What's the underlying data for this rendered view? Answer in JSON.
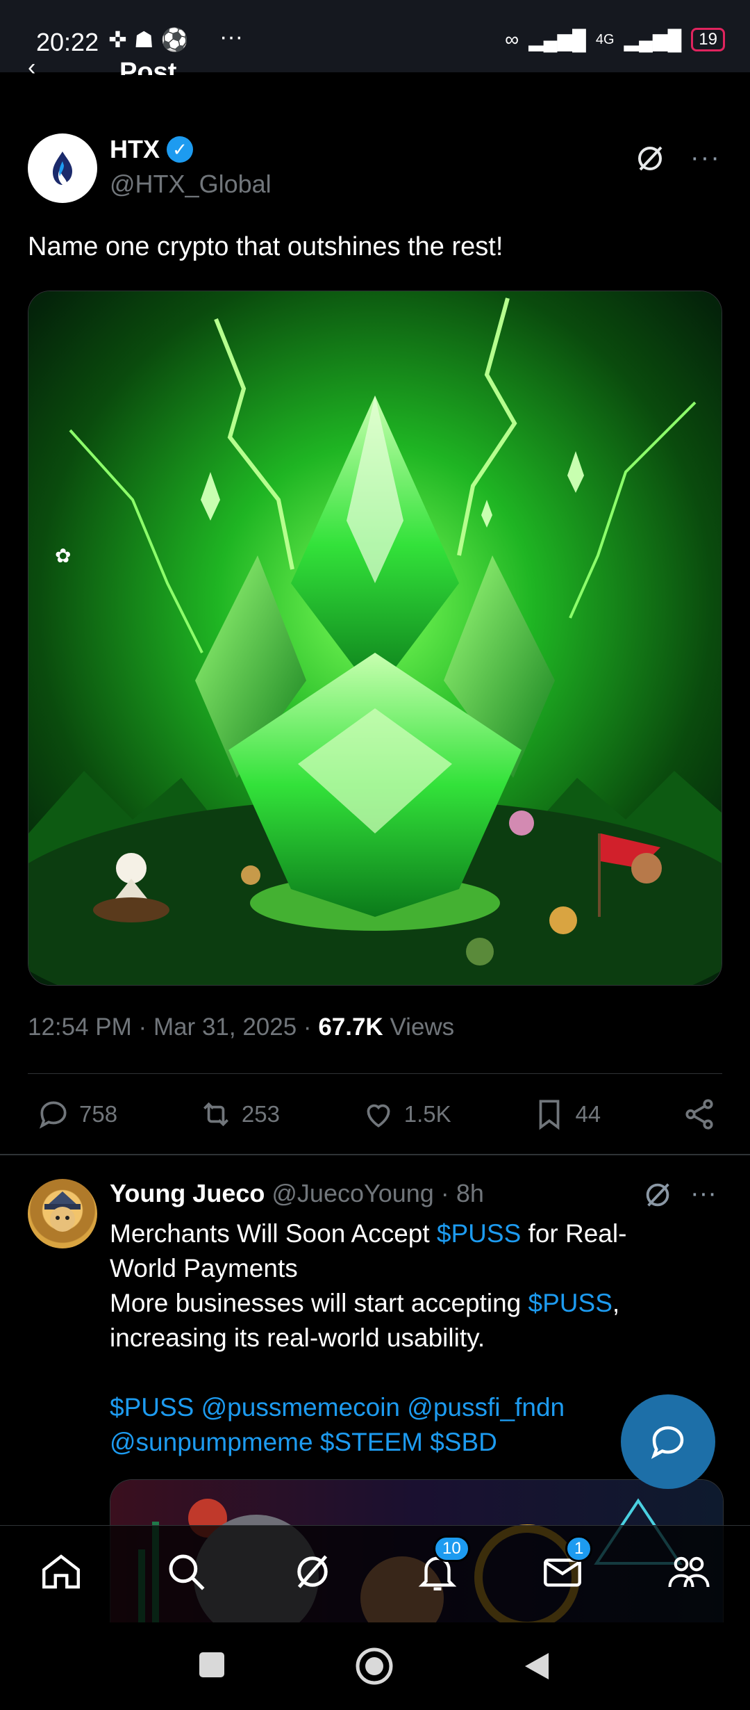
{
  "status_bar": {
    "time": "20:22",
    "left_icons": [
      "game-icon",
      "ghost-icon",
      "soccer-ball-icon"
    ],
    "more": "···",
    "network": "4G",
    "battery": "19"
  },
  "header": {
    "back": "‹",
    "title": "Post"
  },
  "post": {
    "author_name": "HTX",
    "author_handle": "@HTX_Global",
    "verified": true,
    "text": "Name one crypto that outshines the rest!",
    "image_alt": "green crystal artwork",
    "time": "12:54 PM",
    "date": "Mar 31, 2025",
    "views_count": "67.7K",
    "views_label": "Views",
    "separator": "·"
  },
  "actions": {
    "replies": "758",
    "reposts": "253",
    "likes": "1.5K",
    "bookmarks": "44"
  },
  "reply": {
    "name": "Young Jueco",
    "handle": "@JuecoYoung",
    "age": "8h",
    "line1_a": "Merchants Will Soon Accept ",
    "line1_tag": "$PUSS",
    "line1_b": " for Real-World Payments",
    "line2_a": "More businesses will start accepting ",
    "line2_tag": "$PUSS",
    "line2_b": ", increasing its real-world usability.",
    "tags": [
      "$PUSS",
      "@pussmemecoin",
      "@pussfi_fndn",
      "@sunpumpmeme",
      "$STEEM",
      "$SBD"
    ]
  },
  "bottom_nav": {
    "items": [
      "home-icon",
      "search-icon",
      "grok-icon",
      "notifications-icon",
      "messages-icon",
      "communities-icon"
    ],
    "notifications_badge": "10",
    "messages_badge": "1"
  },
  "colors": {
    "accent": "#1d9bf0",
    "background": "#000000",
    "muted": "#71767b",
    "crystal_green": "#2fd13c"
  }
}
